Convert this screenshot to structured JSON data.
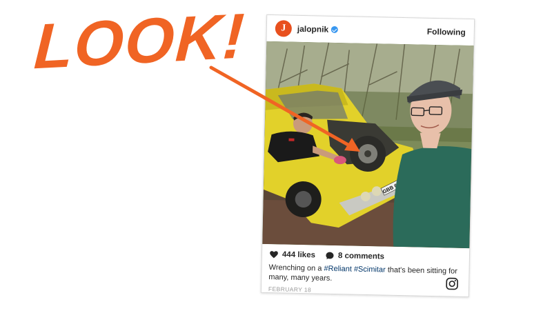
{
  "headline": {
    "text": "LOOK!",
    "color": "#f06424"
  },
  "post": {
    "username": "jalopnik",
    "avatar_letter": "J",
    "verified": true,
    "follow_status": "Following",
    "likes": "444 likes",
    "comments": "8 comments",
    "caption": {
      "pre": "Wrenching on a ",
      "tag1": "#Reliant",
      "space": " ",
      "tag2": "#Scimitar",
      "post": " that's been sitting for many, many years."
    },
    "date": "FEBRUARY 18",
    "plate_text": "GBB 606M"
  },
  "icons": {
    "heart": "heart-icon",
    "comment": "comment-icon",
    "instagram": "instagram-icon",
    "verified": "verified-badge-icon"
  },
  "colors": {
    "accent": "#f06424",
    "avatar_bg": "#e8501e",
    "hashtag": "#003569",
    "verified": "#3897f0"
  }
}
